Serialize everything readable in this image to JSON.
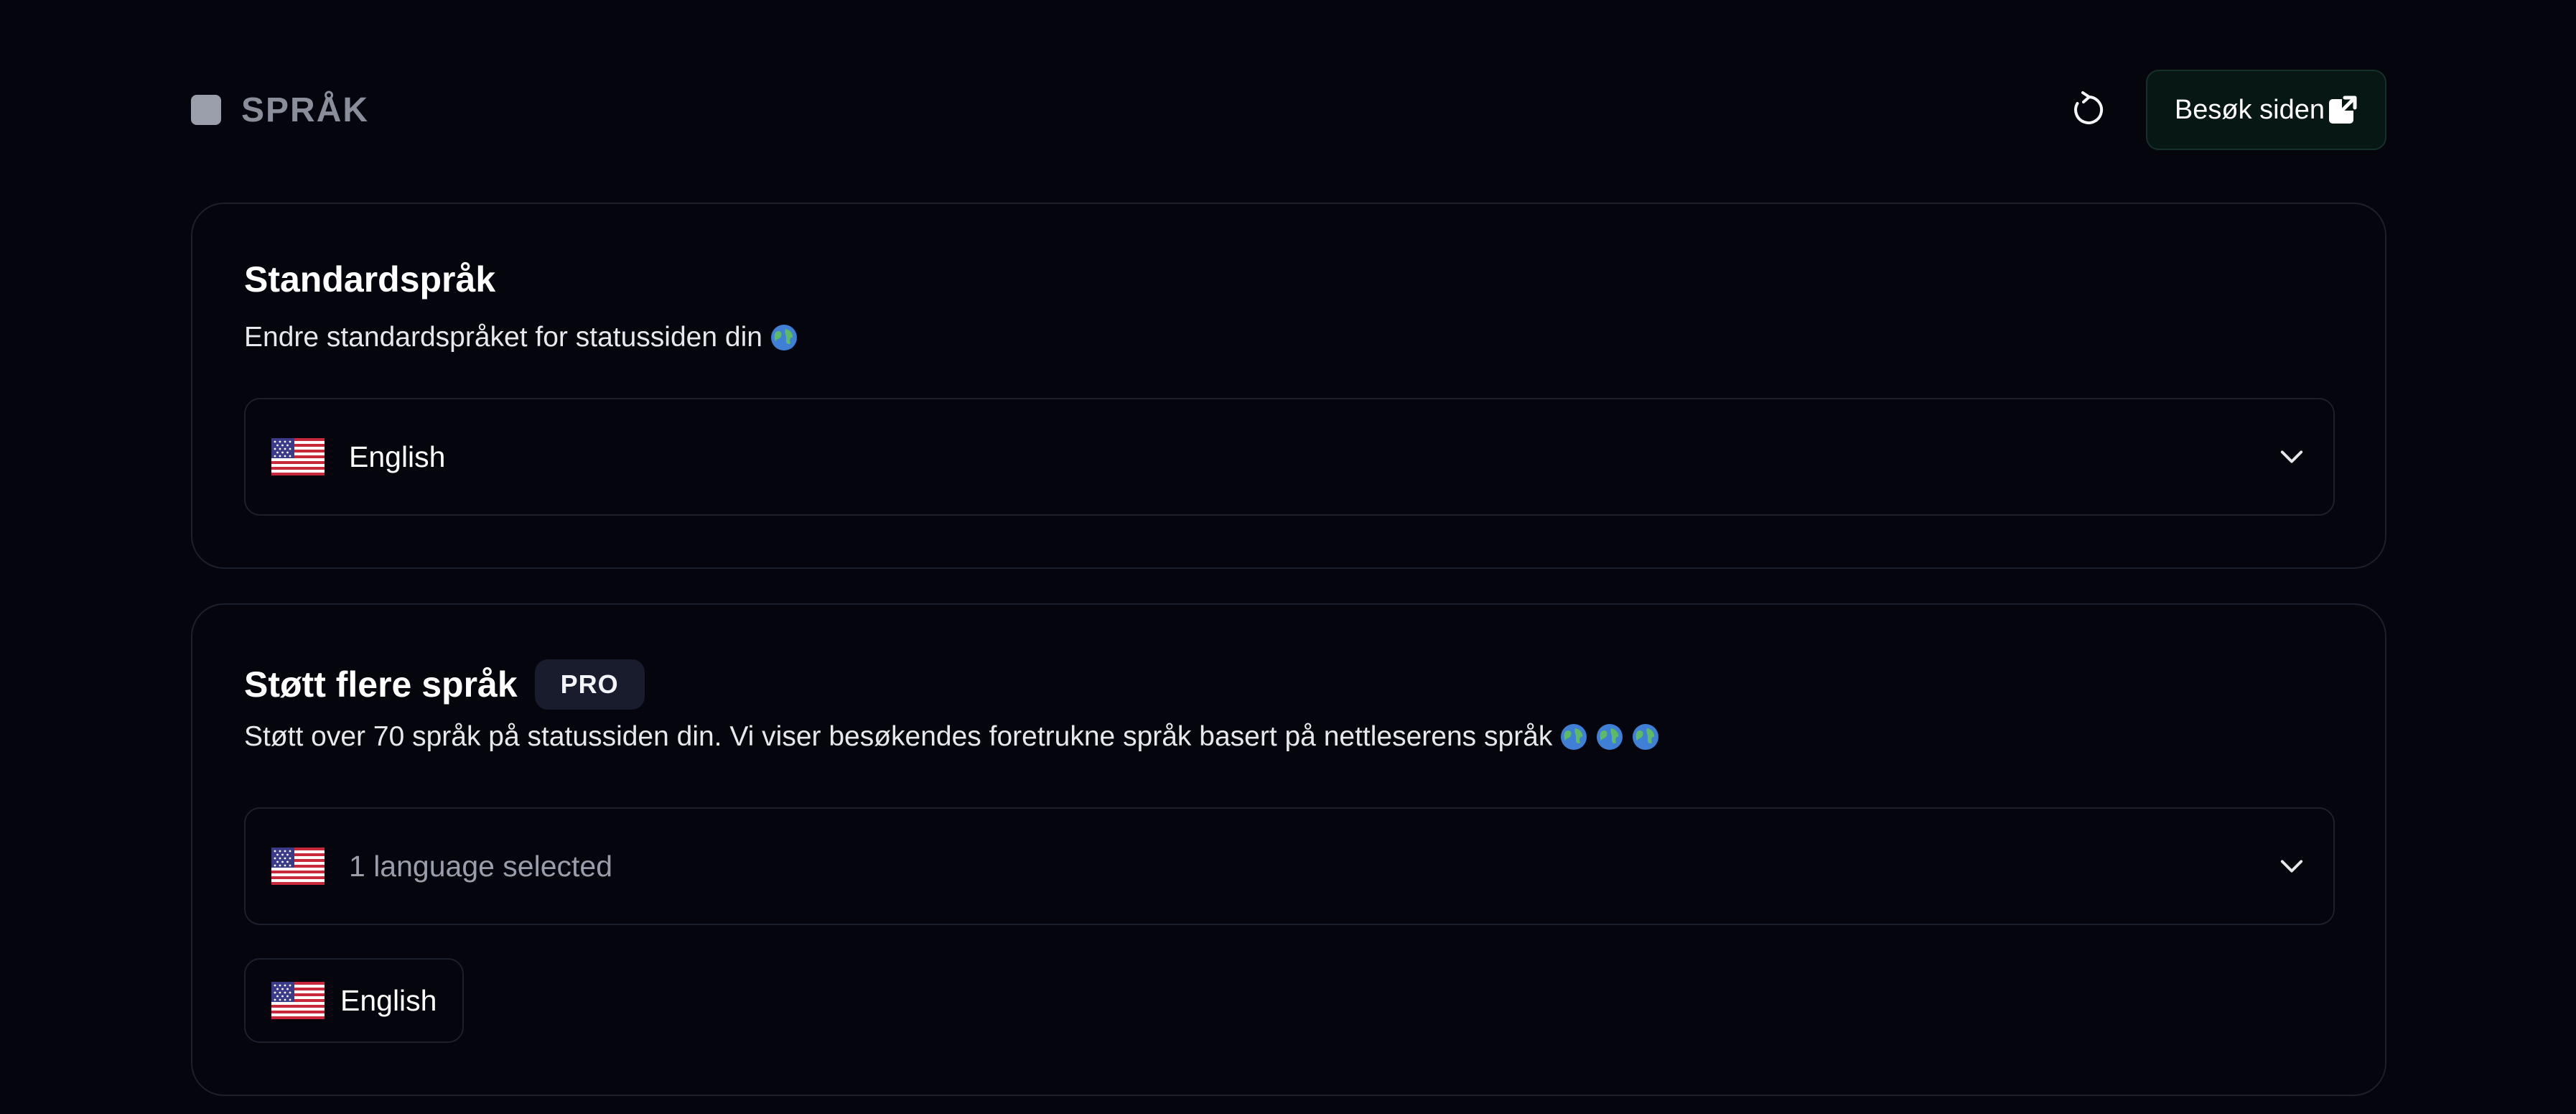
{
  "header": {
    "title": "SPRÅK",
    "visit_button_label": "Besøk siden"
  },
  "default_language": {
    "heading": "Standardspråk",
    "description": "Endre standardspråket for statussiden din",
    "selected_value": "English",
    "flag": "us-flag-icon"
  },
  "multi_language": {
    "heading": "Støtt flere språk",
    "badge": "PRO",
    "description": "Støtt over 70 språk på statussiden din. Vi viser besøkendes foretrukne språk basert på nettleserens språk",
    "selector_text": "1 language selected",
    "selected_chips": [
      {
        "label": "English",
        "flag": "us-flag-icon"
      }
    ]
  },
  "colors": {
    "background": "#05060d",
    "card_border": "#1c1f2c",
    "visit_button_bg": "#071714",
    "badge_bg": "#181c2c"
  }
}
